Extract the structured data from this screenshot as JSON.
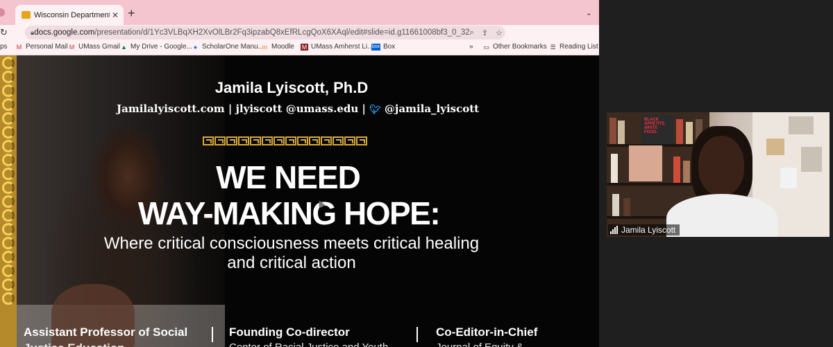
{
  "browser": {
    "tab_title": "Wisconsin Department of Publ",
    "new_tab_symbol": "+",
    "tab_close_symbol": "✕",
    "tab_menu_symbol": "⌄",
    "address": {
      "host": "docs.google.com",
      "path": "/presentation/d/1Yc3VLBqXH2XvOlLBr2Fq3ipzabQ8xEfRLcgQoX6XAql/edit#slide=id.g11661008bf3_0_32"
    },
    "bookmarks": [
      {
        "label": "ps",
        "icon": "apps-icon"
      },
      {
        "label": "Personal Mail",
        "icon": "mail-icon"
      },
      {
        "label": "UMass Gmail",
        "icon": "gmail-icon"
      },
      {
        "label": "My Drive - Google...",
        "icon": "drive-icon"
      },
      {
        "label": "ScholarOne Manu...",
        "icon": "scholarone-icon"
      },
      {
        "label": "Moodle",
        "icon": "moodle-icon"
      },
      {
        "label": "UMass Amherst Li...",
        "icon": "umass-icon"
      },
      {
        "label": "Box",
        "icon": "box-icon"
      }
    ],
    "bookmarks_overflow": "»",
    "other_bookmarks": "Other Bookmarks",
    "reading_list": "Reading List"
  },
  "slide": {
    "name": "Jamila Lyiscott, Ph.D",
    "contact_site": "Jamilalyiscott.com",
    "contact_email": "| jlyiscott @umass.edu |",
    "contact_twitter": "@jamila_lyiscott",
    "title_line1": "WE NEED",
    "title_line2": "WAY-MAKING HOPE:",
    "subtitle": "Where critical consciousness meets critical healing and critical action",
    "roles": [
      {
        "label": "Assistant Professor of Social",
        "cut": "Justice Education"
      },
      {
        "label": "Founding Co-director",
        "cut": "Center of Racial Justice and Youth"
      },
      {
        "label": "Co-Editor-in-Chief",
        "cut": "Journal of Equity &"
      }
    ]
  },
  "video": {
    "participant_name": "Jamila Lyiscott",
    "book_text": "BLACK APPETITE. WHITE FOOD."
  },
  "colors": {
    "tab_strip": "#f4c4cf",
    "slide_bg": "#050505",
    "gold": "#d9aa3a",
    "twitter_blue": "#1da1f2"
  }
}
